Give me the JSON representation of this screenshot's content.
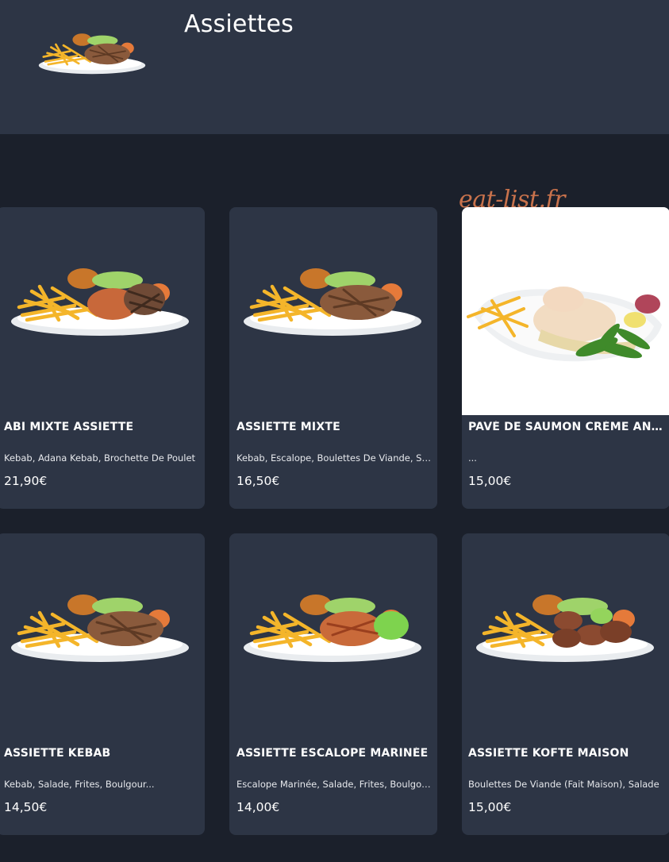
{
  "header": {
    "title": "Assiettes"
  },
  "watermark": "eat-list.fr",
  "colors": {
    "header_bg": "#2d3545",
    "page_bg": "#1b202b",
    "card_bg": "#2d3545",
    "watermark": "#c8724c"
  },
  "items": [
    {
      "name": "ABI MIXTE ASSIETTE",
      "description": "Kebab, Adana Kebab, Brochette De Poulet",
      "price": "21,90€"
    },
    {
      "name": "ASSIETTE MIXTE",
      "description": "Kebab, Escalope, Boulettes De Viande, Salade",
      "price": "16,50€"
    },
    {
      "name": "PAVÉ DE SAUMON CRÈME ANETH",
      "description": "...",
      "price": "15,00€"
    },
    {
      "name": "ASSIETTE KEBAB",
      "description": "Kebab, Salade, Frites, Boulgour...",
      "price": "14,50€"
    },
    {
      "name": "ASSIETTE ESCALOPE MARINÉE",
      "description": "Escalope Marinée, Salade, Frites, Boulgour",
      "price": "14,00€"
    },
    {
      "name": "ASSIETTE KOFTE MAISON",
      "description": "Boulettes De Viande (Fait Maison), Salade",
      "price": "15,00€"
    }
  ]
}
